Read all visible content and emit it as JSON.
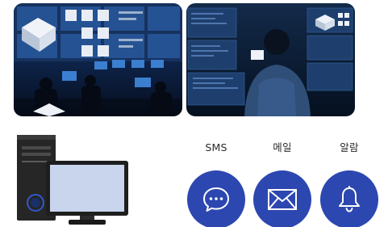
{
  "photos": {
    "left": {
      "icon": "control-room-photo"
    },
    "right": {
      "icon": "operator-monitors-photo"
    }
  },
  "computer": {
    "icon": "desktop-computer-icon"
  },
  "channels": [
    {
      "label": "SMS",
      "icon": "chat-bubble-icon"
    },
    {
      "label": "메일",
      "icon": "envelope-icon"
    },
    {
      "label": "알람",
      "icon": "bell-icon"
    }
  ],
  "colors": {
    "accent": "#2c47b0",
    "photo_dark": "#0b1a33",
    "screen_glow": "#3d6fb8"
  }
}
